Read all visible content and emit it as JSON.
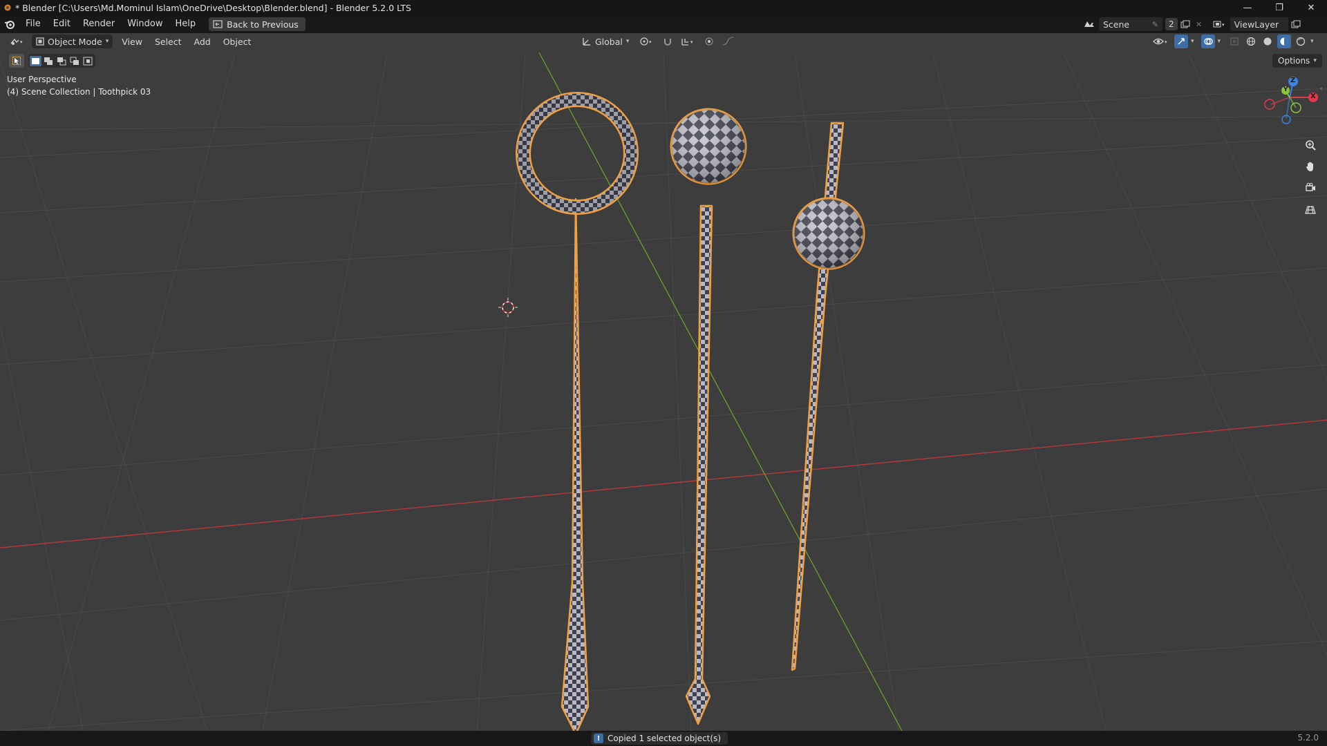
{
  "window": {
    "title": "* Blender [C:\\Users\\Md.Mominul Islam\\OneDrive\\Desktop\\Blender.blend] - Blender 5.2.0 LTS",
    "minimize": "—",
    "maximize": "❐",
    "close": "✕"
  },
  "menu": {
    "items": [
      "File",
      "Edit",
      "Render",
      "Window",
      "Help"
    ],
    "back_button": "Back to Previous"
  },
  "scene": {
    "scene_name": "Scene",
    "scene_count": "2",
    "view_layer": "ViewLayer"
  },
  "viewport_header": {
    "mode": "Object Mode",
    "menus": [
      "View",
      "Select",
      "Add",
      "Object"
    ],
    "orientation": "Global",
    "options_label": "Options"
  },
  "viewport_overlay": {
    "perspective": "User Perspective",
    "collection_info": "(4) Scene Collection | Toothpick 03"
  },
  "gizmo": {
    "x_label": "X",
    "y_label": "Y",
    "z_label": "Z"
  },
  "status": {
    "message": "Copied 1 selected object(s)",
    "version": "5.2.0"
  },
  "colors": {
    "viewport_bg": "#3d3d3d",
    "grid_line": "#4a4a4a",
    "x_axis": "#b83a3a",
    "y_axis": "#6fa82d",
    "selection_outline": "#f0a040",
    "gizmo_x": "#e0384e",
    "gizmo_y": "#8ac53e",
    "gizmo_z": "#3a84e3"
  }
}
